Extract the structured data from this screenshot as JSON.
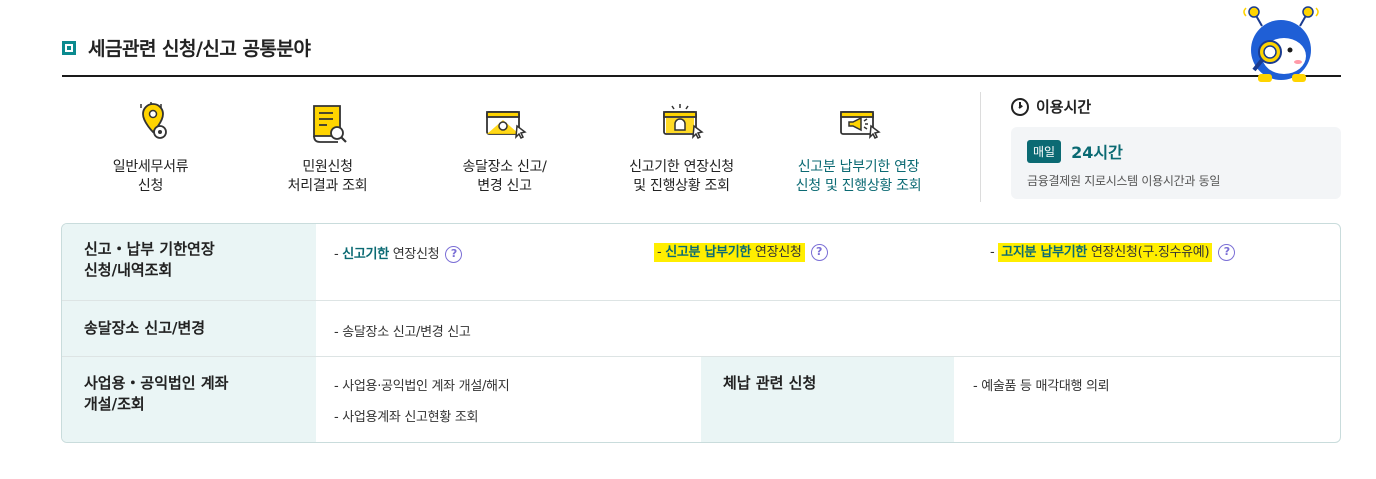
{
  "header": {
    "title": "세금관련 신청/신고 공통분야"
  },
  "menu": {
    "items": [
      {
        "label": "일반세무서류\n신청",
        "icon": "document-gear-icon"
      },
      {
        "label": "민원신청\n처리결과 조회",
        "icon": "document-search-icon"
      },
      {
        "label": "송달장소 신고/\n변경 신고",
        "icon": "monitor-signin-icon"
      },
      {
        "label": "신고기한 연장신청\n및 진행상황 조회",
        "icon": "monitor-alarm-icon"
      },
      {
        "label": "신고분 납부기한 연장\n신청 및 진행상황 조회",
        "icon": "monitor-megaphone-icon"
      }
    ]
  },
  "hours": {
    "title": "이용시간",
    "badge": "매일",
    "value": "24시간",
    "note": "금융결제원 지로시스템 이용시간과 동일"
  },
  "table": {
    "row1": {
      "header": "신고・납부 기한연장\n신청/내역조회",
      "links": [
        {
          "prefix": "- ",
          "strong": "신고기한",
          "rest": " 연장신청",
          "help": "?"
        },
        {
          "prefix": "- ",
          "strong": "신고분 납부기한",
          "rest": " 연장신청",
          "help": "?"
        },
        {
          "prefix": "- ",
          "strong": "고지분 납부기한",
          "rest": " 연장신청(구.징수유예)",
          "help": "?"
        }
      ]
    },
    "row2": {
      "header": "송달장소 신고/변경",
      "link": "- 송달장소 신고/변경 신고"
    },
    "row3": {
      "header": "사업용・공익법인 계좌\n개설/조회",
      "links": [
        "- 사업용·공익법인 계좌 개설/해지",
        "- 사업용계좌 신고현황 조회"
      ],
      "header2": "체납 관련 신청",
      "link2": "- 예술품 등 매각대행 의뢰"
    }
  },
  "colors": {
    "accent": "#0b6a73",
    "highlight": "#ffee00",
    "header_bg": "#eaf5f5",
    "icon_yellow": "#ffd400"
  }
}
